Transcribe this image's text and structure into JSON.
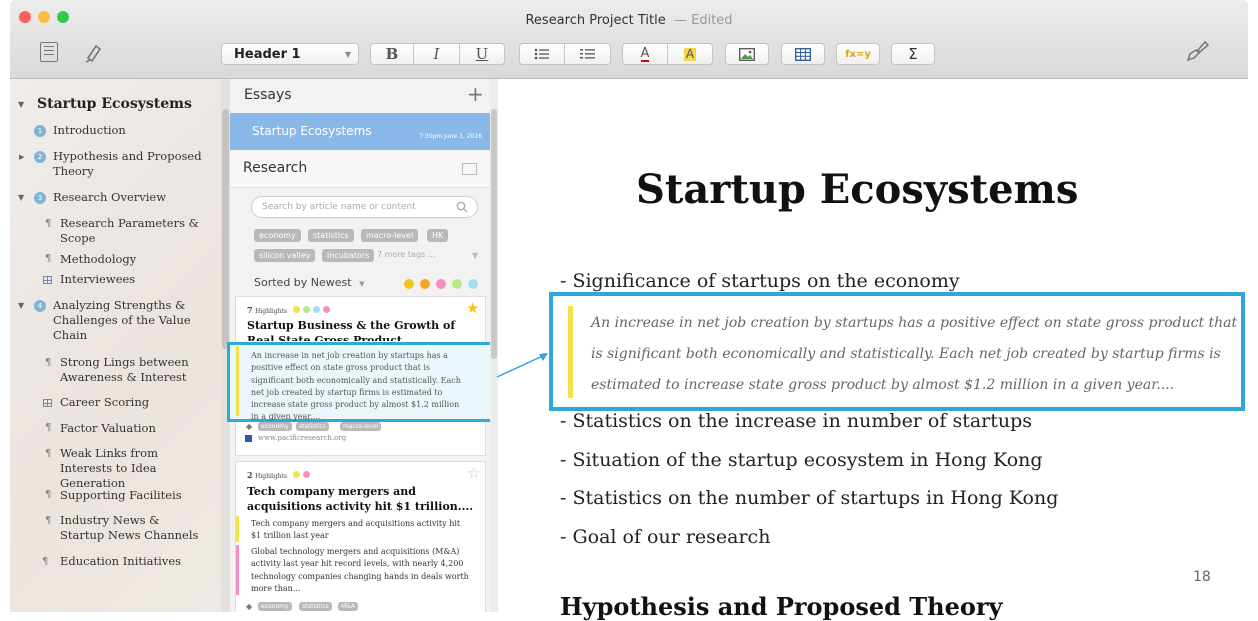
{
  "window": {
    "title": "Research Project Title",
    "status": "— Edited"
  },
  "toolbar": {
    "style_select": "Header 1",
    "bold": "B",
    "italic": "I",
    "underline": "U",
    "text_color": "A",
    "highlight": "A",
    "formula": "fx=y",
    "sum": "Σ"
  },
  "sidebar": {
    "root": "Startup Ecosystems",
    "items": [
      {
        "label": "Introduction",
        "num": "1"
      },
      {
        "label": "Hypothesis and Proposed Theory",
        "num": "2"
      },
      {
        "label": "Research Overview",
        "num": "3"
      },
      {
        "label": "Research Parameters & Scope"
      },
      {
        "label": "Methodology"
      },
      {
        "label": "Interviewees"
      },
      {
        "label": "Analyzing Strengths & Challenges of the Value Chain",
        "num": "4"
      },
      {
        "label": "Strong Lings between Awareness & Interest"
      },
      {
        "label": "Career Scoring"
      },
      {
        "label": "Factor Valuation"
      },
      {
        "label": "Weak Links from Interests to Idea Generation"
      },
      {
        "label": "Supporting Faciliteis"
      },
      {
        "label": "Industry News & Startup News Channels"
      },
      {
        "label": "Education Initiatives"
      }
    ]
  },
  "middle": {
    "essays_title": "Essays",
    "essays_add": "+",
    "selected_essay": "Startup Ecosystems",
    "selected_time": "7:30pm June 1, 2016",
    "research_title": "Research",
    "search_placeholder": "Search by article name or content",
    "tags": [
      "economy",
      "statistics",
      "macro-level",
      "HK",
      "silicon valley",
      "incubators"
    ],
    "more_tags": "7 more tags ...",
    "sort_label": "Sorted by Newest",
    "filter_colors": [
      "#f5c518",
      "#f5a623",
      "#f48fc6",
      "#b8e986",
      "#9ee0ec"
    ],
    "card1": {
      "count": "7",
      "highlights_label": "Highlights",
      "dot_colors": [
        "#f5e04a",
        "#b8e986",
        "#9ee0ec",
        "#f48fc6"
      ],
      "title": "Startup Business & the Growth of Real State Gross Product",
      "excerpt": "An increase in net job creation by startups has a positive effect on state gross product that is significant both economically and statistically. Each net job created by startup firms is estimated to increase state gross product by almost $1.2 million in a given year....",
      "tags": [
        "economy",
        "statistics",
        "macro-level"
      ],
      "source": "www.pacificresearch.org"
    },
    "card2": {
      "count": "2",
      "highlights_label": "Highlights",
      "dot_colors": [
        "#f5e04a",
        "#f48fc6"
      ],
      "title": "Tech company mergers and acquisitions activity hit $1 trillion....",
      "quote1": "Tech company mergers and acquisitions activity hit $1 trillion last year",
      "quote2": "Global technology mergers and acquisitions (M&A) activity last year hit record levels, with nearly 4,200 technology companies changing hands in deals worth more than...",
      "tags": [
        "economy",
        "statistics",
        "M&A"
      ]
    }
  },
  "editor": {
    "heading": "Startup Ecosystems",
    "bullet1": "- Significance of startups on the economy",
    "quote_lines": [
      "An increase in net job creation by startups has a positive effect on state gross product that",
      "is significant both economically and statistically. Each net job created by startup firms is",
      "estimated to increase state gross product by almost $1.2 million in a given year...."
    ],
    "bullets": [
      "- Statistics on the increase in number of startups",
      "- Situation of the startup ecosystem in Hong Kong",
      "- Statistics on the number of startups in Hong Kong",
      "- Goal of our research"
    ],
    "page_number": "18",
    "next_heading": "Hypothesis and Proposed Theory"
  },
  "colors": {
    "accent": "#2ea8d8",
    "selected_bg": "#8ab8e8",
    "quote_bar": "#f5e04a"
  }
}
